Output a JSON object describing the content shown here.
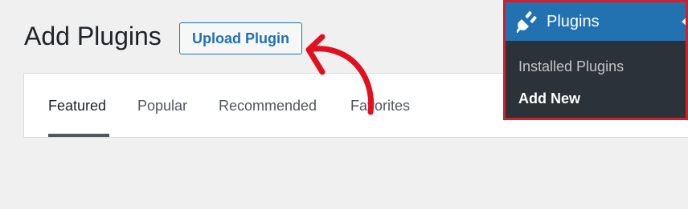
{
  "page": {
    "title": "Add Plugins",
    "upload_button_label": "Upload Plugin"
  },
  "tabs": [
    {
      "label": "Featured",
      "active": true
    },
    {
      "label": "Popular",
      "active": false
    },
    {
      "label": "Recommended",
      "active": false
    },
    {
      "label": "Favorites",
      "active": false
    }
  ],
  "admin_menu": {
    "header": {
      "icon": "plug-icon",
      "label": "Plugins"
    },
    "items": [
      {
        "label": "Installed Plugins",
        "current": false
      },
      {
        "label": "Add New",
        "current": true
      }
    ]
  },
  "colors": {
    "accent": "#2271b1",
    "highlight_border": "#d21f2a",
    "annotation_arrow": "#e0101e",
    "menu_background": "#2c3338"
  }
}
